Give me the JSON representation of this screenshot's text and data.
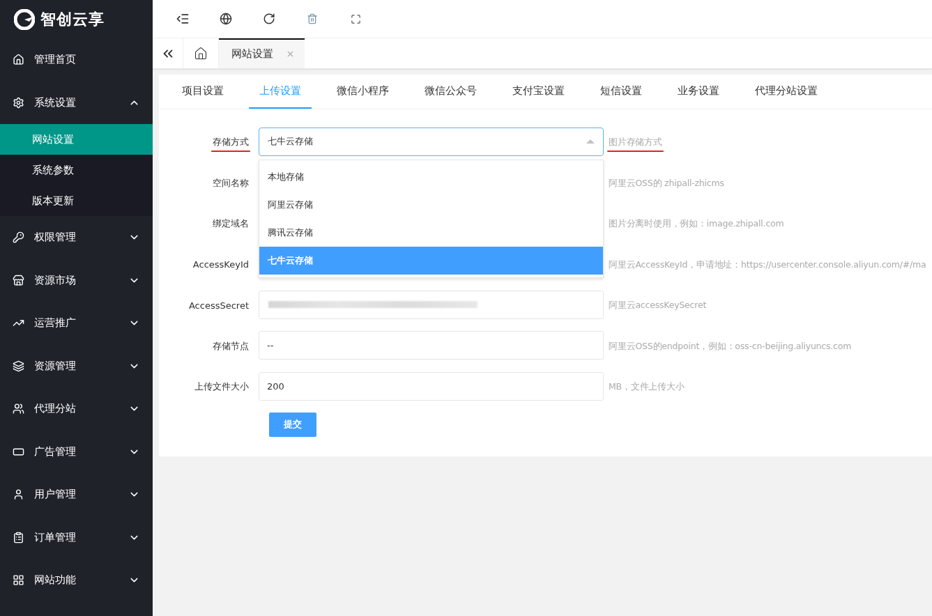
{
  "brand": {
    "name": "智创云享"
  },
  "sidebar": {
    "items": [
      {
        "label": "管理首页",
        "kind": "link"
      },
      {
        "label": "系统设置",
        "kind": "group",
        "expanded": true,
        "children": [
          {
            "label": "网站设置",
            "selected": true
          },
          {
            "label": "系统参数",
            "selected": false
          },
          {
            "label": "版本更新",
            "selected": false
          }
        ]
      },
      {
        "label": "权限管理",
        "kind": "group",
        "expanded": false
      },
      {
        "label": "资源市场",
        "kind": "group",
        "expanded": false
      },
      {
        "label": "运营推广",
        "kind": "group",
        "expanded": false
      },
      {
        "label": "资源管理",
        "kind": "group",
        "expanded": false
      },
      {
        "label": "代理分站",
        "kind": "group",
        "expanded": false
      },
      {
        "label": "广告管理",
        "kind": "group",
        "expanded": false
      },
      {
        "label": "用户管理",
        "kind": "group",
        "expanded": false
      },
      {
        "label": "订单管理",
        "kind": "group",
        "expanded": false
      },
      {
        "label": "网站功能",
        "kind": "group",
        "expanded": false
      }
    ]
  },
  "page_tabs": [
    {
      "label": "网站设置",
      "selected": true
    }
  ],
  "settings_tabs": [
    {
      "label": "项目设置",
      "selected": false
    },
    {
      "label": "上传设置",
      "selected": true
    },
    {
      "label": "微信小程序",
      "selected": false
    },
    {
      "label": "微信公众号",
      "selected": false
    },
    {
      "label": "支付宝设置",
      "selected": false
    },
    {
      "label": "短信设置",
      "selected": false
    },
    {
      "label": "业务设置",
      "selected": false
    },
    {
      "label": "代理分站设置",
      "selected": false
    }
  ],
  "form": {
    "fields": [
      {
        "label": "存储方式",
        "kind": "select",
        "value": "七牛云存储",
        "expanded": true,
        "underlined": true,
        "hint": "图片存储方式",
        "hint_underlined": true,
        "options": [
          {
            "label": "本地存储",
            "selected": false
          },
          {
            "label": "阿里云存储",
            "selected": false
          },
          {
            "label": "腾讯云存储",
            "selected": false
          },
          {
            "label": "七牛云存储",
            "selected": true
          }
        ]
      },
      {
        "label": "空间名称",
        "kind": "covered",
        "hint": "阿里云OSS的 zhipall-zhicms"
      },
      {
        "label": "绑定域名",
        "kind": "covered",
        "hint": "图片分离时使用，例如：image.zhipall.com"
      },
      {
        "label": "AccessKeyId",
        "kind": "covered",
        "hint": "阿里云AccessKeyId，申请地址：https://usercenter.console.aliyun.com/#/ma"
      },
      {
        "label": "AccessSecret",
        "kind": "input",
        "redacted": true,
        "hint": "阿里云accessKeySecret"
      },
      {
        "label": "存储节点",
        "kind": "input",
        "value": "--",
        "hint": "阿里云OSS的endpoint，例如：oss-cn-beijing.aliyuncs.com"
      },
      {
        "label": "上传文件大小",
        "kind": "input",
        "value": "200",
        "hint": "MB，文件上传大小"
      }
    ],
    "submit": "提交"
  }
}
